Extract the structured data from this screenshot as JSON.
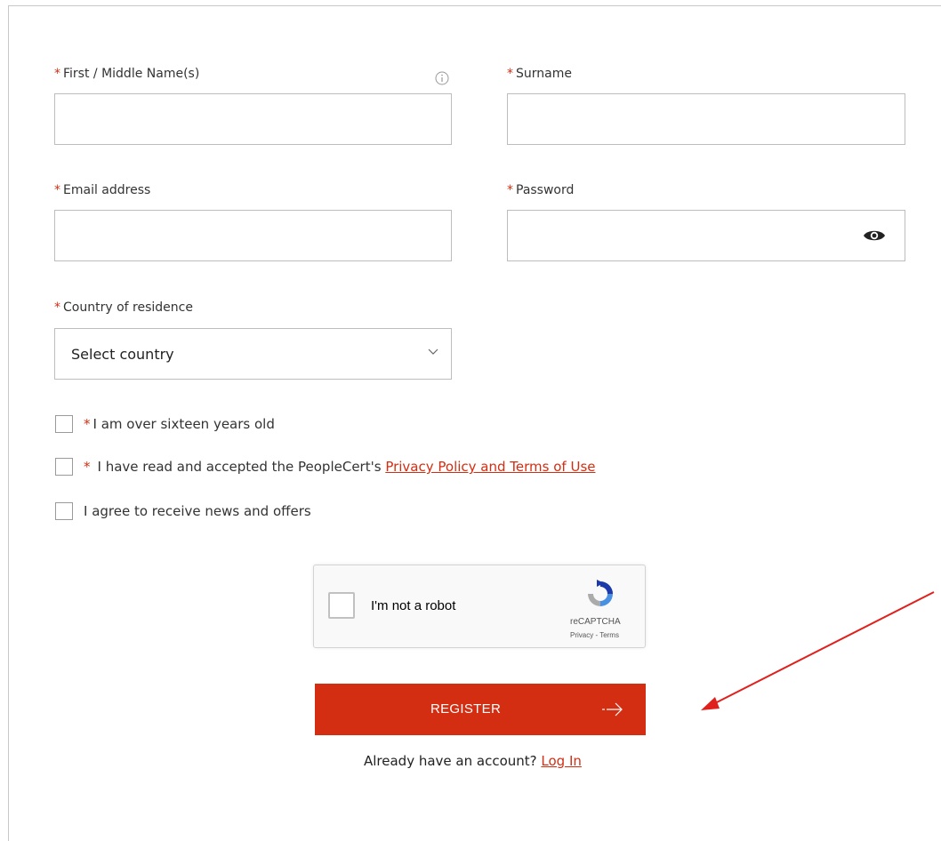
{
  "form": {
    "first_name": {
      "required_mark": "*",
      "label": "First / Middle Name(s)",
      "value": ""
    },
    "surname": {
      "required_mark": "*",
      "label": "Surname",
      "value": ""
    },
    "email": {
      "required_mark": "*",
      "label": "Email address",
      "value": ""
    },
    "password": {
      "required_mark": "*",
      "label": "Password",
      "value": ""
    },
    "country": {
      "required_mark": "*",
      "label": "Country of residence",
      "selected": "Select country"
    },
    "checkboxes": [
      {
        "required_mark": "*",
        "text": "I am over sixteen years old",
        "checked": false
      },
      {
        "required_mark": "*",
        "text": "I have read and accepted the PeopleCert's ",
        "link": "Privacy Policy and Terms of Use",
        "checked": false
      },
      {
        "required_mark": "",
        "text": "I agree to receive news and offers",
        "checked": false
      }
    ]
  },
  "captcha": {
    "label": "I'm not a robot",
    "brand": "reCAPTCHA",
    "links": "Privacy - Terms"
  },
  "register_button": {
    "label": "REGISTER"
  },
  "login": {
    "prompt": "Already have an account?",
    "link": "Log In"
  },
  "colors": {
    "accent": "#d42e12",
    "annotation_arrow": "#e0201c"
  },
  "icons": {
    "info": "info-icon",
    "password_toggle": "eye-icon",
    "dropdown": "chevron-down-icon",
    "arrow": "arrow-right-icon"
  }
}
